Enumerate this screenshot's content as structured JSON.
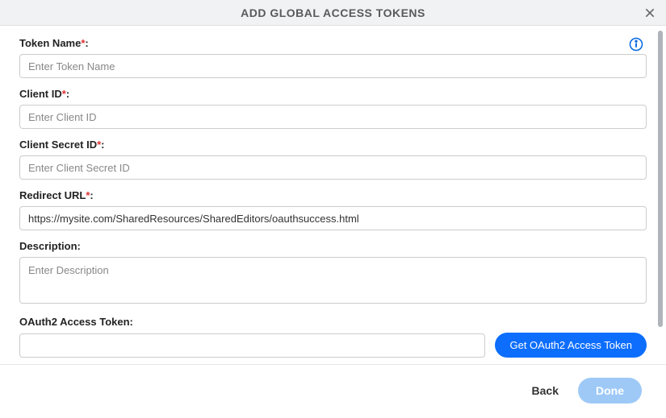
{
  "dialog": {
    "title": "ADD GLOBAL ACCESS TOKENS"
  },
  "form": {
    "tokenName": {
      "label": "Token Name",
      "required": "*",
      "colon": ":",
      "placeholder": "Enter Token Name",
      "value": ""
    },
    "clientId": {
      "label": "Client ID",
      "required": "*",
      "colon": ":",
      "placeholder": "Enter Client ID",
      "value": ""
    },
    "clientSecretId": {
      "label": "Client Secret ID",
      "required": "*",
      "colon": ":",
      "placeholder": "Enter Client Secret ID",
      "value": ""
    },
    "redirectUrl": {
      "label": "Redirect URL",
      "required": "*",
      "colon": ":",
      "placeholder": "",
      "value": "https://mysite.com/SharedResources/SharedEditors/oauthsuccess.html"
    },
    "description": {
      "label": "Description:",
      "placeholder": "Enter Description",
      "value": ""
    },
    "oauthToken": {
      "label": "OAuth2 Access Token:",
      "placeholder": "",
      "value": "",
      "buttonLabel": "Get OAuth2 Access Token"
    }
  },
  "footer": {
    "back": "Back",
    "done": "Done"
  }
}
